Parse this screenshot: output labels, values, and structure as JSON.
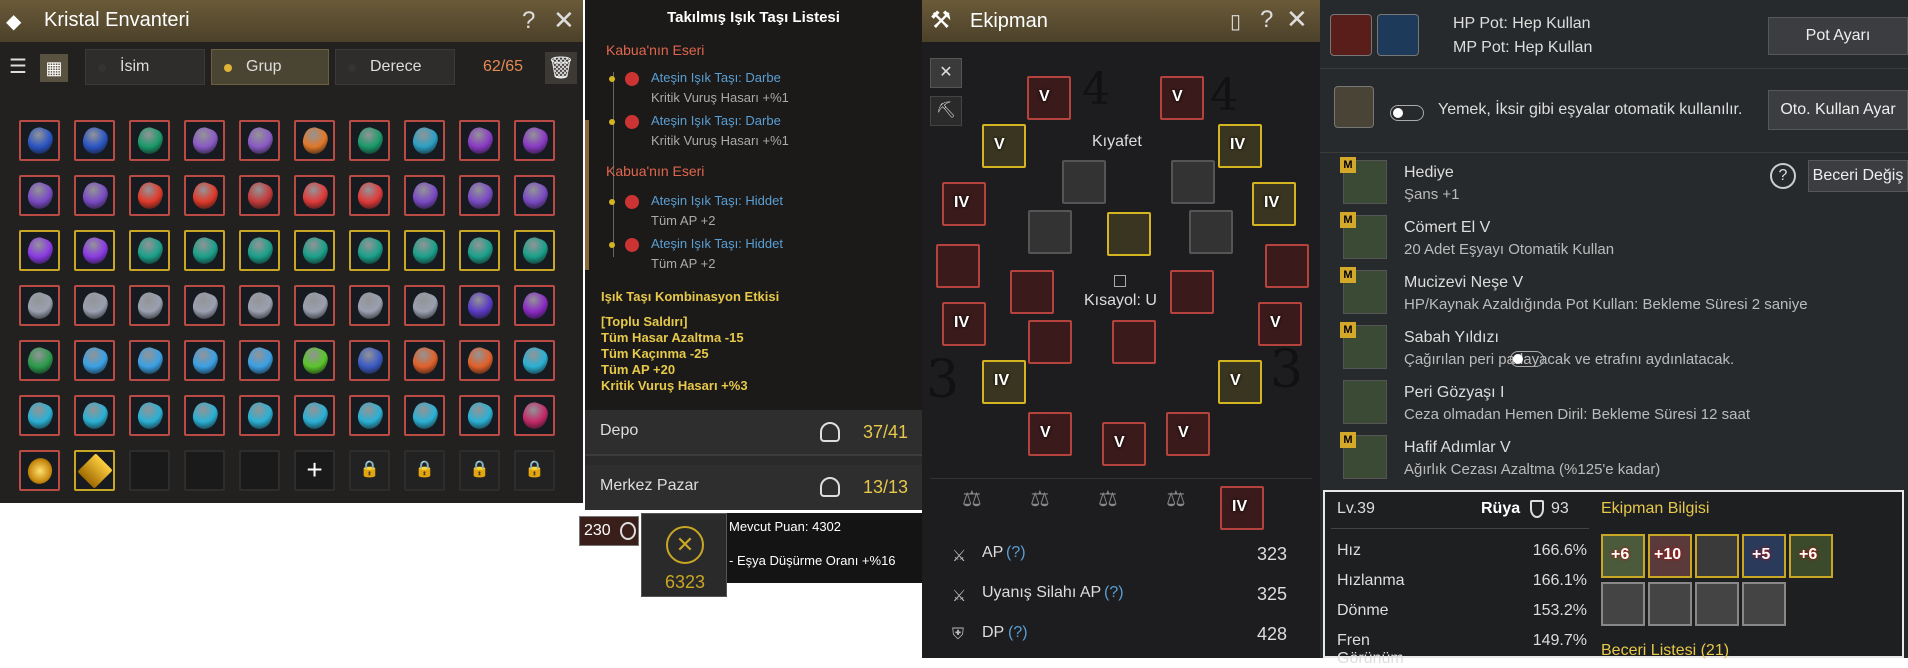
{
  "inventory": {
    "title": "Kristal Envanteri",
    "sort_tabs": [
      "İsim",
      "Grup",
      "Derece"
    ],
    "count": "62/65"
  },
  "light_stones": {
    "title": "Takılmış Işık Taşı Listesi",
    "groups": [
      {
        "source": "Kabua'nın Eseri",
        "items": [
          {
            "name": "Ateşin Işık Taşı: Darbe",
            "effect": "Kritik Vuruş Hasarı +%1"
          },
          {
            "name": "Ateşin Işık Taşı: Darbe",
            "effect": "Kritik Vuruş Hasarı +%1"
          }
        ]
      },
      {
        "source": "Kabua'nın Eseri",
        "items": [
          {
            "name": "Ateşin Işık Taşı: Hiddet",
            "effect": "Tüm AP +2"
          },
          {
            "name": "Ateşin Işık Taşı: Hiddet",
            "effect": "Tüm AP +2"
          }
        ]
      }
    ],
    "combo_title": "Işık Taşı Kombinasyon Etkisi",
    "combo_name": "[Toplu Saldırı]",
    "combo_effects": [
      "Tüm Hasar Azaltma -15",
      "Tüm Kaçınma -25",
      "Tüm AP +20",
      "Kritik Vuruş Hasarı +%3"
    ]
  },
  "storage": [
    {
      "label": "Depo",
      "value": "37/41"
    },
    {
      "label": "Merkez Pazar",
      "value": "13/13"
    }
  ],
  "points": {
    "badge_count": "230",
    "seal_value": "6323",
    "current": "Mevcut Puan: 4302",
    "drop_rate": "- Eşya Düşürme Oranı +%16"
  },
  "equipment": {
    "title": "Ekipman",
    "costume_label": "Kıyafet",
    "shortcut_label": "Kısayol: U",
    "handwritten": [
      "4",
      "4",
      "3",
      "3"
    ],
    "gear_marks": [
      "V",
      "V",
      "V",
      "IV",
      "IV",
      "IV",
      "IV",
      "V",
      "IV",
      "V",
      "V",
      "V",
      "V",
      "IV"
    ],
    "stats": [
      {
        "label": "AP",
        "help": "(?)",
        "value": "323"
      },
      {
        "label": "Uyanış Silahı AP",
        "help": "(?)",
        "value": "325"
      },
      {
        "label": "DP",
        "help": "(?)",
        "value": "428"
      }
    ]
  },
  "potions": {
    "hp": "HP Pot: Hep Kullan",
    "mp": "MP Pot: Hep Kullan",
    "settings_btn": "Pot Ayarı",
    "auto_text": "Yemek, İksir gibi eşyalar otomatik kullanılır.",
    "auto_btn": "Oto. Kullan Ayar"
  },
  "pet_skills": {
    "change_btn": "Beceri Değiş",
    "help": "?",
    "skills": [
      {
        "badge": "M",
        "name": "Hediye",
        "desc": "Şans +1"
      },
      {
        "badge": "M",
        "name": "Cömert El V",
        "desc": "20 Adet Eşyayı Otomatik Kullan"
      },
      {
        "badge": "M",
        "name": "Mucizevi Neşe V",
        "desc": "HP/Kaynak Azaldığında Pot Kullan: Bekleme Süresi 2 saniye"
      },
      {
        "badge": "M",
        "name": "Sabah Yıldızı",
        "desc": "Çağırılan peri parlayacak ve etrafını aydınlatacak."
      },
      {
        "badge": "",
        "name": "Peri Gözyaşı I",
        "desc": "Ceza olmadan Hemen Diril: Bekleme Süresi 12 saat"
      },
      {
        "badge": "M",
        "name": "Hafif Adımlar V",
        "desc": "Ağırlık Cezası Azaltma (%125'e kadar)"
      }
    ]
  },
  "pet_stats": {
    "level": "Lv.39",
    "name": "Rüya",
    "power": "93",
    "rows": [
      {
        "label": "Hız",
        "value": "166.6%"
      },
      {
        "label": "Hızlanma",
        "value": "166.1%"
      },
      {
        "label": "Dönme",
        "value": "153.2%"
      },
      {
        "label": "Fren",
        "value": "149.7%"
      }
    ],
    "cut_label": "Görünüm",
    "equip_title": "Ekipman Bilgisi",
    "equip_enh": [
      "+6",
      "+10",
      "",
      "+5",
      "+6"
    ],
    "skill_list": "Beceri Listesi (21)"
  },
  "colors": {
    "accent": "#d4b521",
    "red_border": "#b3433c",
    "link_blue": "#5a9fd4",
    "source_red": "#e0664e",
    "combo_yellow": "#e6c84a"
  }
}
